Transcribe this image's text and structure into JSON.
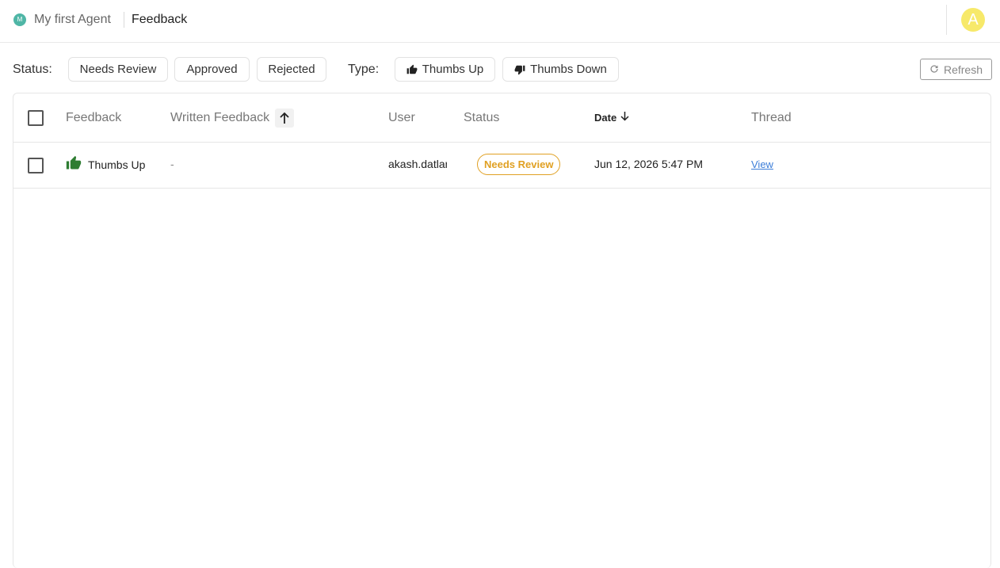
{
  "header": {
    "agent_initial": "M",
    "agent_name": "My first Agent",
    "page_title": "Feedback",
    "avatar_initial": "A"
  },
  "filters": {
    "status_label": "Status:",
    "status_options": [
      "Needs Review",
      "Approved",
      "Rejected"
    ],
    "type_label": "Type:",
    "type_options": [
      "Thumbs Up",
      "Thumbs Down"
    ],
    "refresh_label": "Refresh"
  },
  "table": {
    "columns": [
      "Feedback",
      "Written Feedback",
      "User",
      "Status",
      "Date",
      "Thread"
    ],
    "rows": [
      {
        "feedback": "Thumbs Up",
        "written_feedback": "-",
        "user": "akash.datlani",
        "status": "Needs Review",
        "date": "Jun 12, 2026 5:47 PM",
        "thread": "View"
      }
    ]
  },
  "colors": {
    "agent_dot": "#4fb6a6",
    "avatar": "#f7e96a",
    "thumbs_up_icon": "#2e7d32",
    "needs_review": "#e0a022",
    "link": "#3b7dd8"
  }
}
